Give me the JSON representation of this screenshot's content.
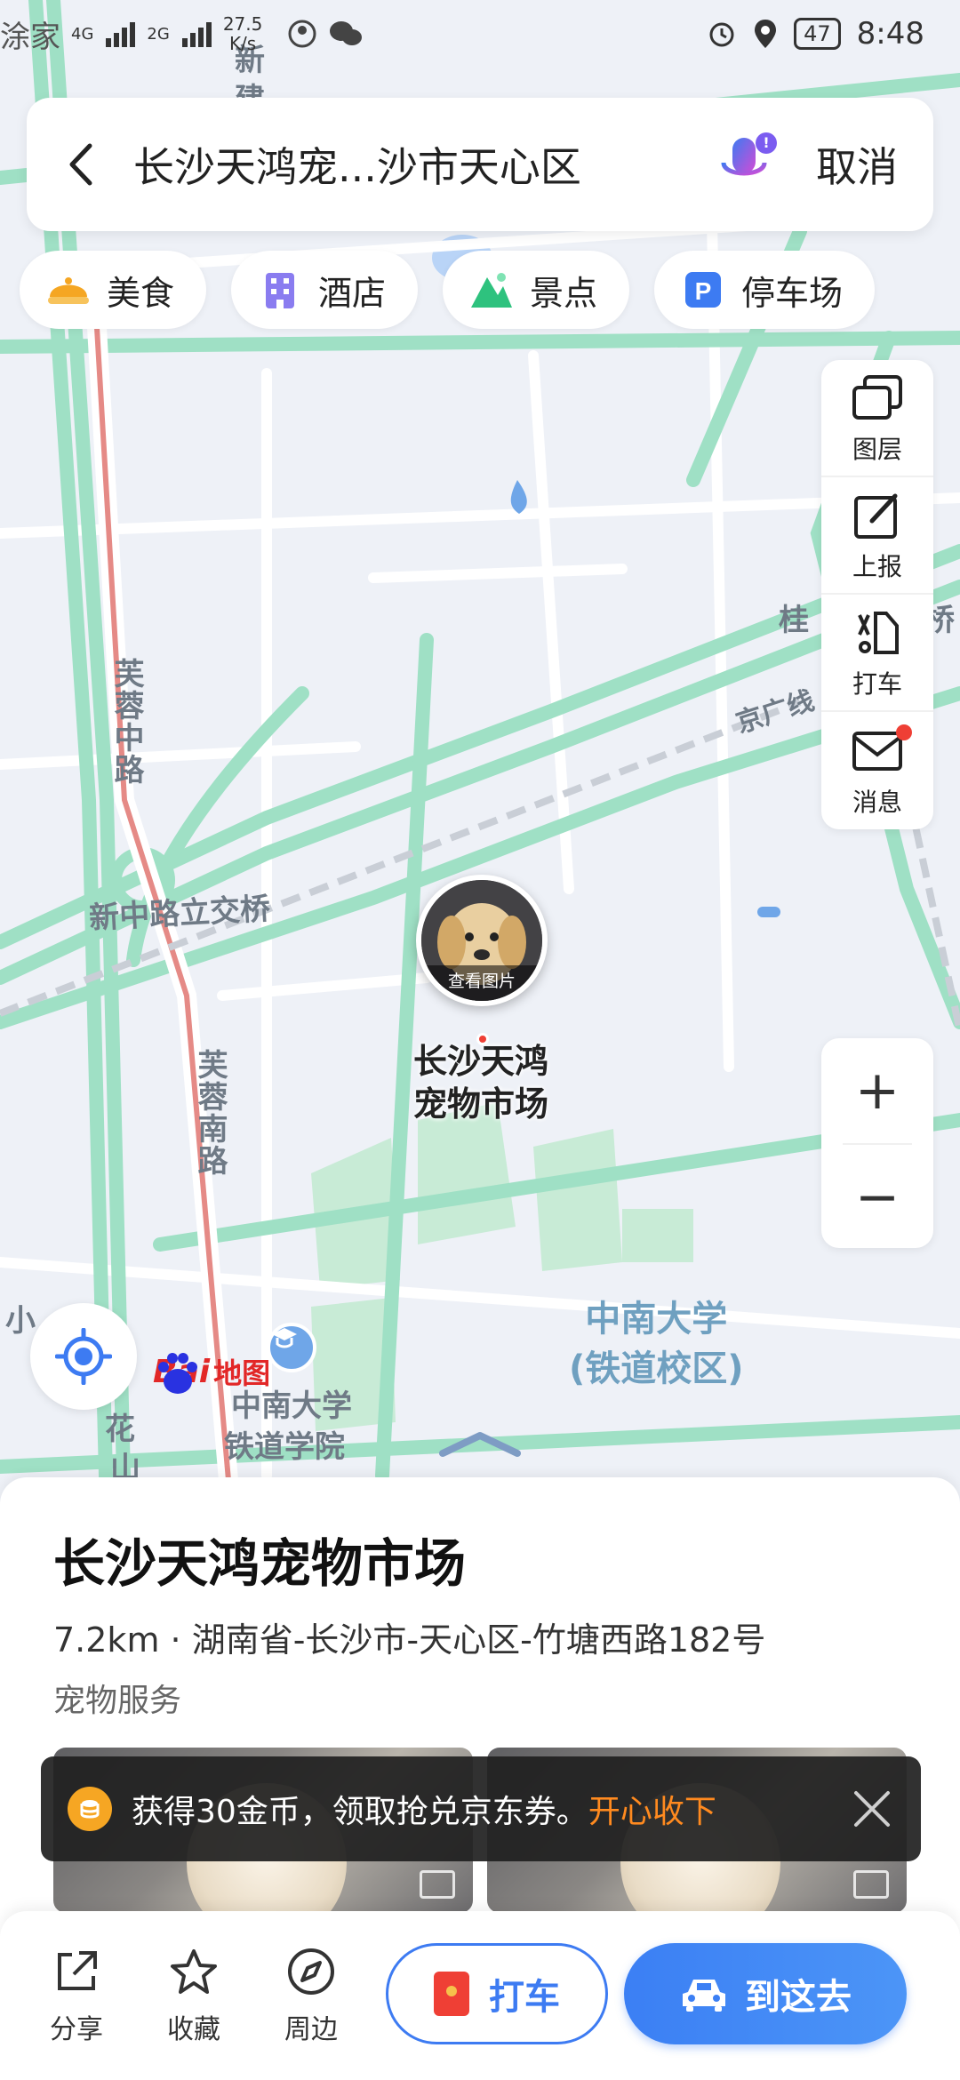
{
  "status_bar": {
    "carrier": "涂家",
    "signal_1": "4G",
    "signal_2": "2G",
    "net_speed": "27.5",
    "net_speed_unit": "K/s",
    "battery": "47",
    "time": "8:48"
  },
  "search": {
    "query": "长沙天鸿宠...沙市天心区",
    "cancel_label": "取消"
  },
  "categories": [
    {
      "label": "美食",
      "icon": "food-icon",
      "color": "#f5a623"
    },
    {
      "label": "酒店",
      "icon": "hotel-icon",
      "color": "#8a7cf0"
    },
    {
      "label": "景点",
      "icon": "scenic-icon",
      "color": "#2ec27e"
    },
    {
      "label": "停车场",
      "icon": "parking-icon",
      "color": "#3d7bf2"
    }
  ],
  "tools": [
    {
      "label": "图层",
      "icon": "layers-icon"
    },
    {
      "label": "上报",
      "icon": "report-icon"
    },
    {
      "label": "打车",
      "icon": "taxi-icon"
    },
    {
      "label": "消息",
      "icon": "message-icon",
      "badge": true
    }
  ],
  "zoom": {
    "in": "+",
    "out": "−"
  },
  "map": {
    "labels": {
      "furong_middle": "芙蓉中路",
      "furong_south": "芙蓉南路",
      "xinzhong_interchange": "新中路立交桥",
      "jingguang": "京广线",
      "gui": "桂",
      "gui_right": "桥",
      "xin_top": "新",
      "xin_top2": "建",
      "campus": "中南大学\n(铁道校区)",
      "railway_college_line1": "中南大学",
      "railway_college_line2": "铁道学院",
      "xiao": "小",
      "hua": "花",
      "shan": "山"
    },
    "pin_caption": "查看图片",
    "pin_name_line1": "长沙天鸿",
    "pin_name_line2": "宠物市场",
    "logo": {
      "bai": "Bai",
      "du": "du",
      "ditu": "地图"
    }
  },
  "poi": {
    "title": "长沙天鸿宠物市场",
    "address": "7.2km · 湖南省-长沙市-天心区-竹塘西路182号",
    "category": "宠物服务"
  },
  "toast": {
    "text": "获得30金币，领取抢兑京东券。",
    "link": "开心收下"
  },
  "actions": {
    "share": "分享",
    "favorite": "收藏",
    "nearby": "周边",
    "taxi": "打车",
    "go": "到这去"
  },
  "colors": {
    "road": "#9fe0c5",
    "road_edge": "#7fd3b2",
    "main_road_red": "#e58a86",
    "accent": "#3d7bf2",
    "green_field": "#c8ebd6"
  }
}
